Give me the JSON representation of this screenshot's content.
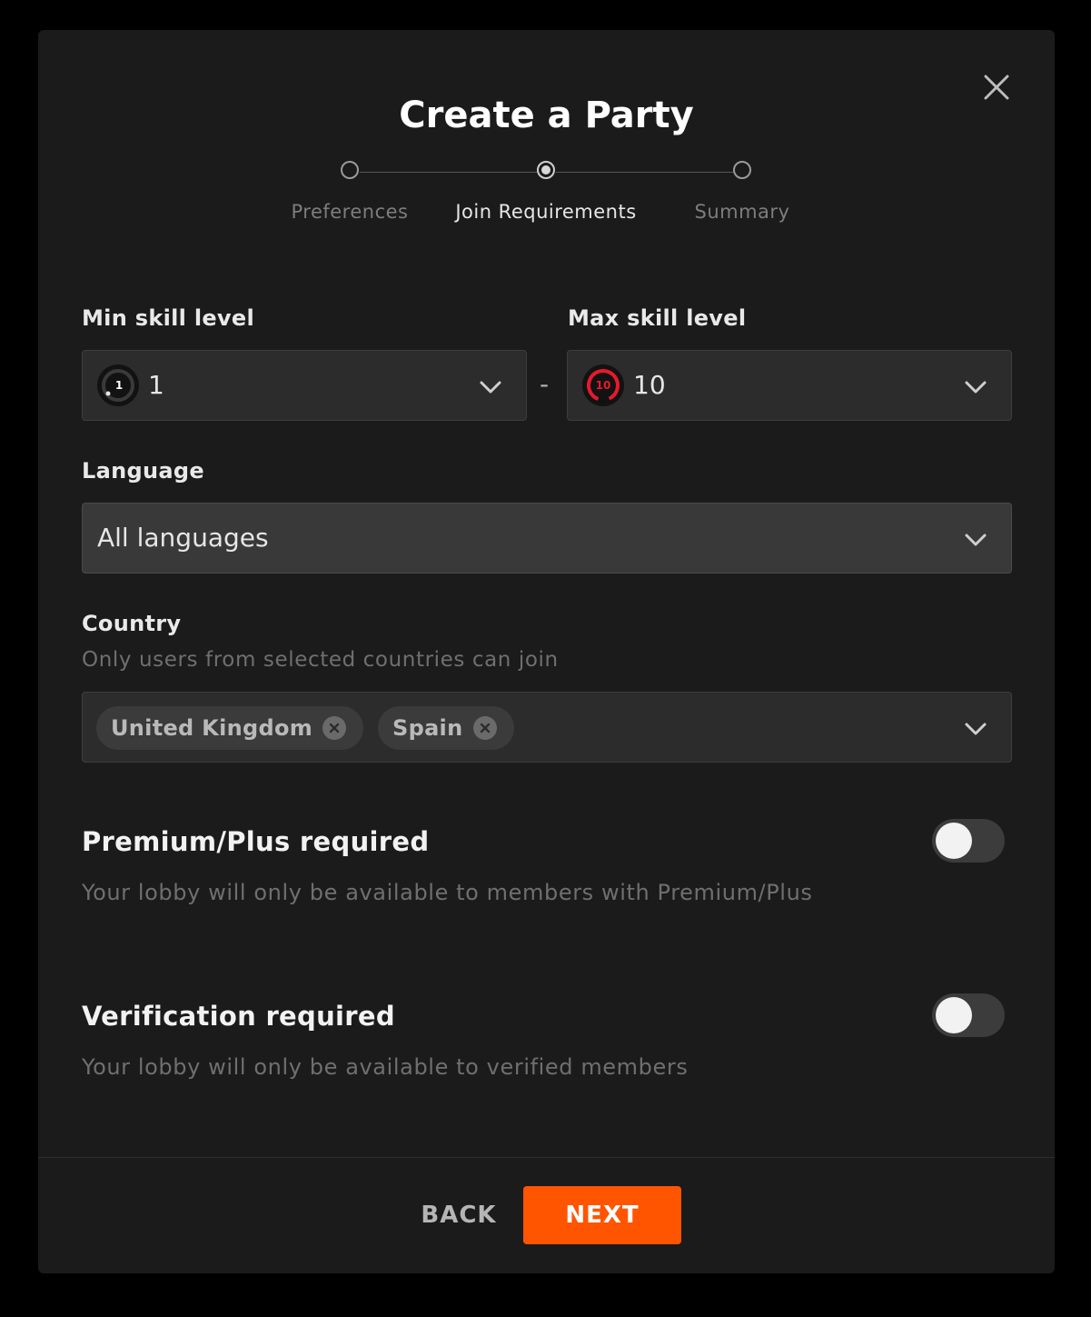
{
  "modal": {
    "title": "Create a Party"
  },
  "stepper": {
    "steps": [
      {
        "label": "Preferences",
        "active": false
      },
      {
        "label": "Join Requirements",
        "active": true
      },
      {
        "label": "Summary",
        "active": false
      }
    ]
  },
  "skill": {
    "min_label": "Min skill level",
    "min_value": "1",
    "min_badge": "1",
    "separator": "-",
    "max_label": "Max skill level",
    "max_value": "10",
    "max_badge": "10"
  },
  "language": {
    "label": "Language",
    "value": "All languages"
  },
  "country": {
    "label": "Country",
    "hint": "Only users from selected countries can join",
    "selected": [
      "United Kingdom",
      "Spain"
    ]
  },
  "premium": {
    "title": "Premium/Plus required",
    "description": "Your lobby will only be available to members with Premium/Plus",
    "enabled": false
  },
  "verification": {
    "title": "Verification required",
    "description": "Your lobby will only be available to verified members",
    "enabled": false
  },
  "footer": {
    "back_label": "BACK",
    "next_label": "NEXT"
  },
  "colors": {
    "accent": "#ff5500",
    "skill_max": "#e8192c",
    "background": "#1b1b1b"
  },
  "icons": {
    "close": "close-icon",
    "chevron": "chevron-down-icon",
    "chip_remove": "remove-chip-icon"
  }
}
